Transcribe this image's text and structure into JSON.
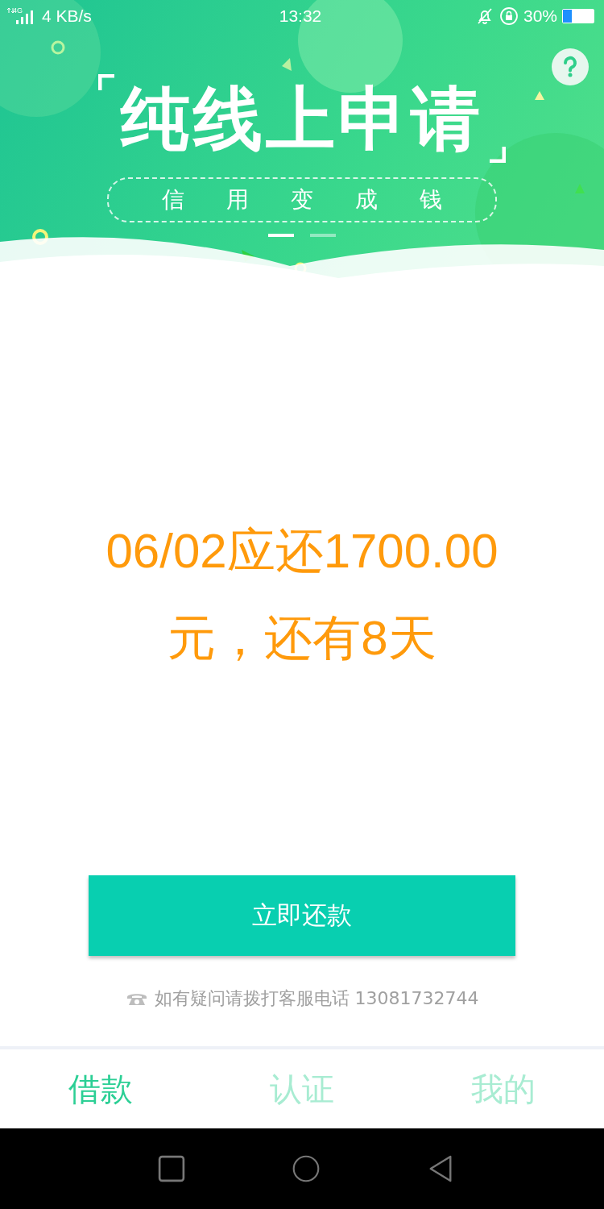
{
  "status_bar": {
    "network": "4G",
    "speed": "4 KB/s",
    "time": "13:32",
    "battery_text": "30%",
    "battery": {
      "level": 0.3
    }
  },
  "banner": {
    "title": "纯线上申请",
    "subtitle": "信用变成钱",
    "pages": [
      {
        "selected": true
      },
      {
        "selected": false
      }
    ]
  },
  "due_notice": "06/02应还1700.00元，还有8天",
  "repay_button": "立即还款",
  "hotline": "如有疑问请拨打客服电话 13081732744",
  "tabs": [
    {
      "label": "借款",
      "selected": true
    },
    {
      "label": "认证",
      "selected": false
    },
    {
      "label": "我的",
      "selected": false
    }
  ]
}
